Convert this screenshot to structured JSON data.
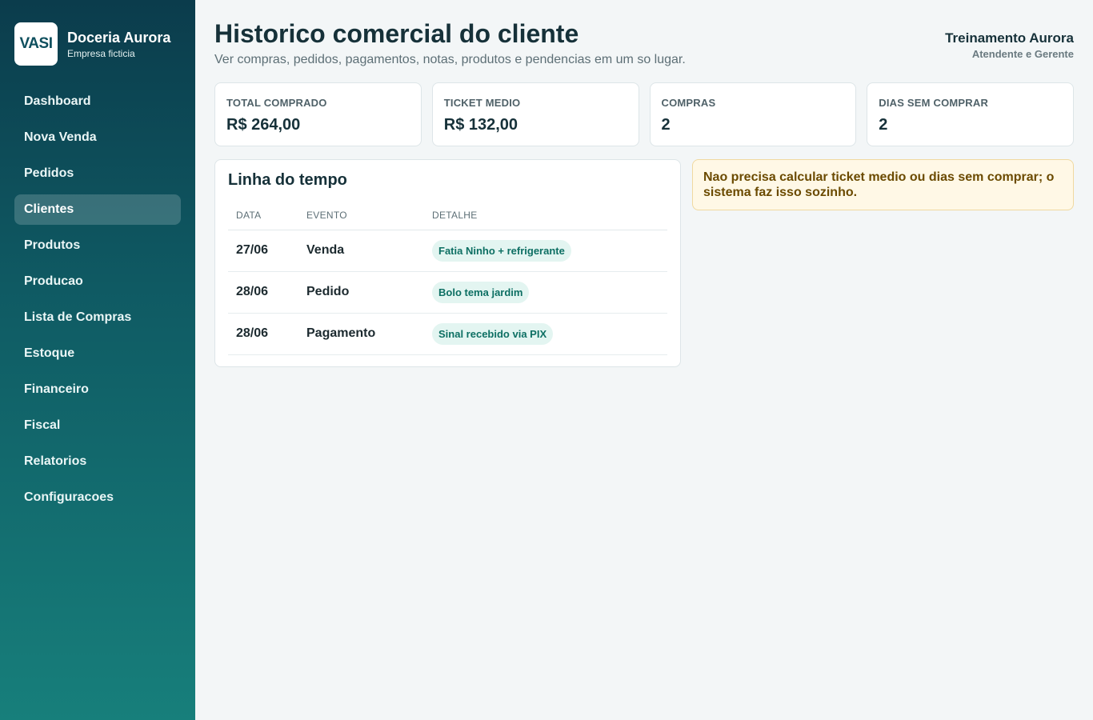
{
  "brand": {
    "logo_text": "VASI",
    "name": "Doceria Aurora",
    "subtitle": "Empresa ficticia"
  },
  "sidebar": {
    "items": [
      {
        "label": "Dashboard",
        "active": false
      },
      {
        "label": "Nova Venda",
        "active": false
      },
      {
        "label": "Pedidos",
        "active": false
      },
      {
        "label": "Clientes",
        "active": true
      },
      {
        "label": "Produtos",
        "active": false
      },
      {
        "label": "Producao",
        "active": false
      },
      {
        "label": "Lista de Compras",
        "active": false
      },
      {
        "label": "Estoque",
        "active": false
      },
      {
        "label": "Financeiro",
        "active": false
      },
      {
        "label": "Fiscal",
        "active": false
      },
      {
        "label": "Relatorios",
        "active": false
      },
      {
        "label": "Configuracoes",
        "active": false
      }
    ]
  },
  "header": {
    "title": "Historico comercial do cliente",
    "subtitle": "Ver compras, pedidos, pagamentos, notas, produtos e pendencias em um so lugar."
  },
  "user": {
    "name": "Treinamento Aurora",
    "role": "Atendente e Gerente"
  },
  "stats": [
    {
      "label": "TOTAL COMPRADO",
      "value": "R$ 264,00"
    },
    {
      "label": "TICKET MEDIO",
      "value": "R$ 132,00"
    },
    {
      "label": "COMPRAS",
      "value": "2"
    },
    {
      "label": "DIAS SEM COMPRAR",
      "value": "2"
    }
  ],
  "timeline": {
    "title": "Linha do tempo",
    "columns": [
      "DATA",
      "EVENTO",
      "DETALHE"
    ],
    "rows": [
      {
        "data": "27/06",
        "evento": "Venda",
        "detalhe": "Fatia Ninho + refrigerante"
      },
      {
        "data": "28/06",
        "evento": "Pedido",
        "detalhe": "Bolo tema jardim"
      },
      {
        "data": "28/06",
        "evento": "Pagamento",
        "detalhe": "Sinal recebido via PIX"
      }
    ]
  },
  "notice": {
    "text": "Nao precisa calcular ticket medio ou dias sem comprar; o sistema faz isso sozinho."
  },
  "colors": {
    "sidebar_top": "#0b3c4c",
    "sidebar_bottom": "#177f7b",
    "pill_bg": "#e3f5f1",
    "pill_text": "#0d6f63",
    "notice_bg": "#fff8e6",
    "notice_text": "#6b4a00"
  }
}
